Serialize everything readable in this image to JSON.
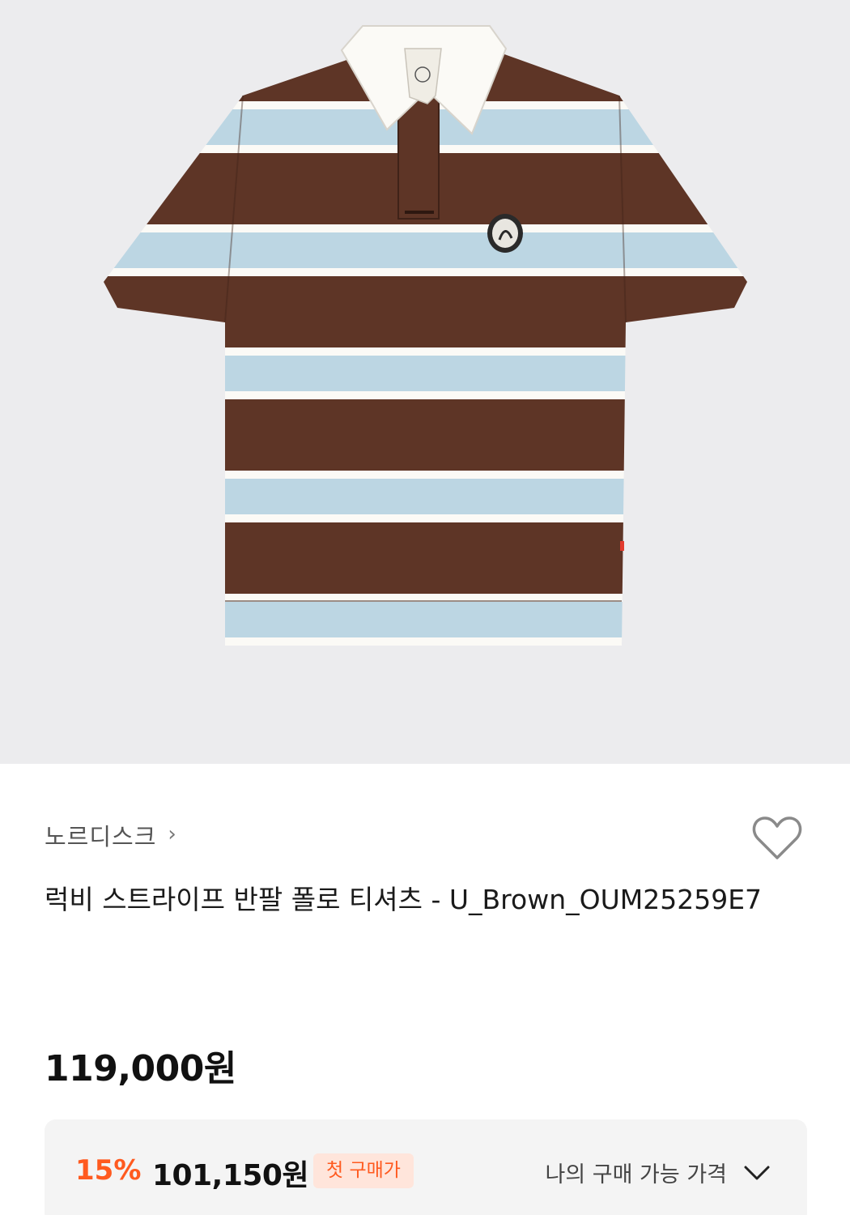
{
  "product": {
    "brand": "노르디스크",
    "brand_chevron": "›",
    "title": "럭비 스트라이프 반팔 폴로 티셔츠 - U_Brown_OUM25259E7",
    "price": "119,000원"
  },
  "discount": {
    "percent": "15%",
    "price": "101,150원",
    "badge": "첫 구매가",
    "my_price_label": "나의 구매 가능 가격"
  },
  "icons": {
    "wishlist": "heart-outline-icon",
    "brand_link": "chevron-right-icon",
    "expand": "chevron-down-icon"
  },
  "colors": {
    "accent": "#ff5a1f",
    "badge_bg": "#ffe5db",
    "stripe_brown": "#5e3526",
    "stripe_blue": "#bcd6e3",
    "stripe_white": "#fbfaf6",
    "background": "#ececee"
  }
}
